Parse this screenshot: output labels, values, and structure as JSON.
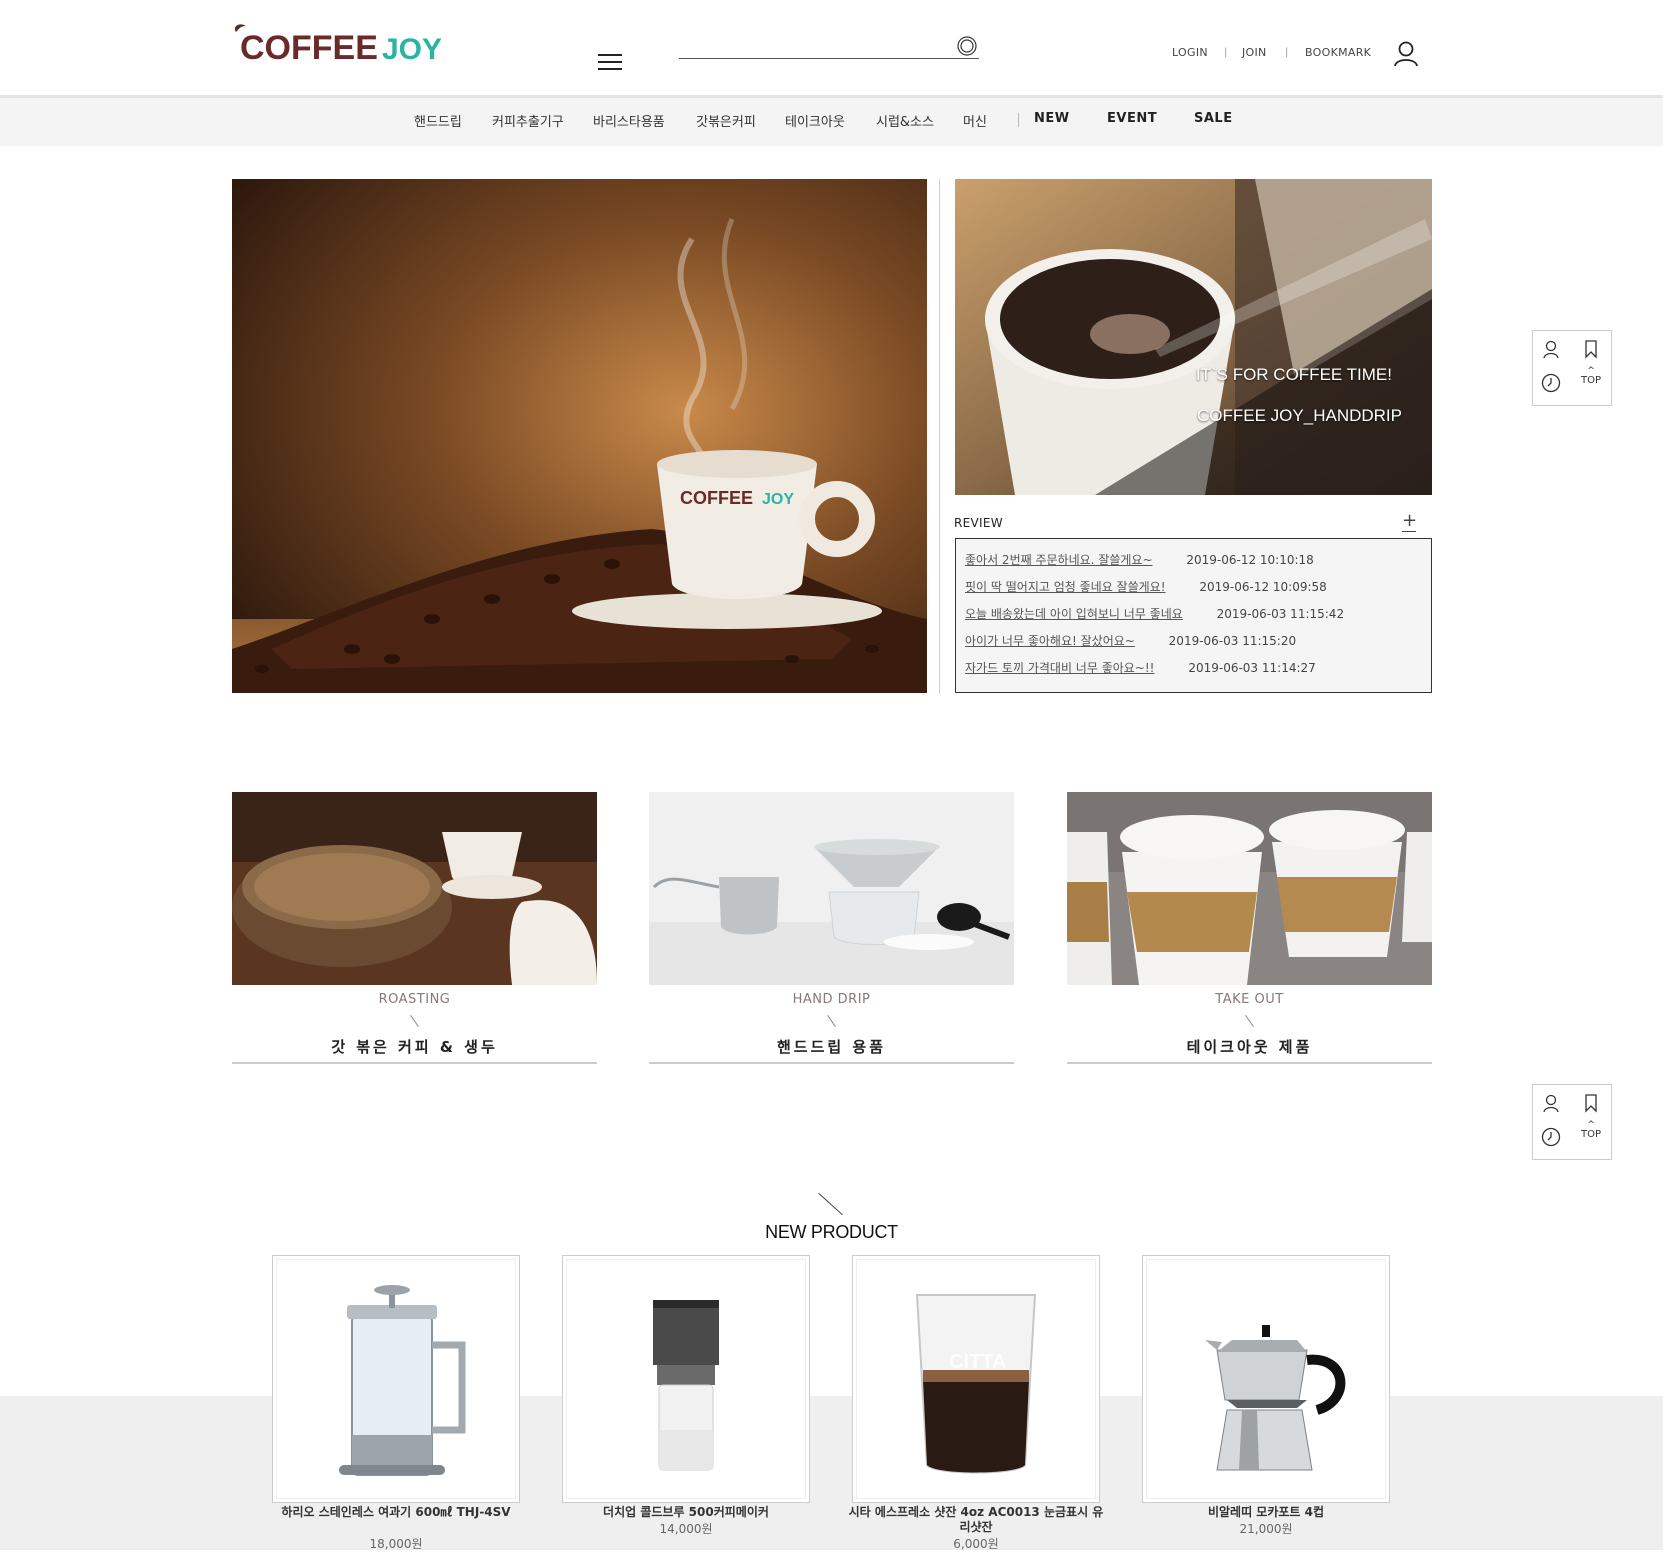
{
  "header": {
    "logo_text_main": "COFFEE",
    "logo_text_accent": "JOY",
    "search_placeholder": "",
    "links": {
      "login": "LOGIN",
      "join": "JOIN",
      "bookmark": "BOOKMARK",
      "separator": "|"
    }
  },
  "nav": {
    "items": [
      "핸드드립",
      "커피추출기구",
      "바리스타용품",
      "갓볶은커피",
      "테이크아웃",
      "시럽&소스",
      "머신"
    ],
    "strong_items": [
      "NEW",
      "EVENT",
      "SALE"
    ]
  },
  "hero": {
    "cup_logo_main": "COFFEE",
    "cup_logo_accent": "JOY",
    "title": "IT`S FOR COFFEE TIME!",
    "subtitle": "COFFEE JOY_HANDDRIP"
  },
  "review": {
    "title": "REVIEW",
    "more": "+",
    "items": [
      {
        "text": "좋아서 2번째 주문하네요. 잘쓸게요~",
        "date": "2019-06-12 10:10:18"
      },
      {
        "text": "핏이 딱 떨어지고 엄청 좋네요 잘쓸게요!",
        "date": "2019-06-12 10:09:58"
      },
      {
        "text": "오늘 배송왔는데 아이 입혀보니 너무 좋네요",
        "date": "2019-06-03 11:15:42"
      },
      {
        "text": "아이가 너무 좋아해요! 잘샀어요~",
        "date": "2019-06-03 11:15:20"
      },
      {
        "text": "자가드 토끼 가격대비 너무 좋아요~!!",
        "date": "2019-06-03 11:14:27"
      }
    ]
  },
  "quick": {
    "top_label": "TOP"
  },
  "categories": [
    {
      "en": "ROASTING",
      "ko": "갓 볶은 커피 & 생두"
    },
    {
      "en": "HAND DRIP",
      "ko": "핸드드립 용품"
    },
    {
      "en": "TAKE  OUT",
      "ko": "테이크아웃 제품"
    }
  ],
  "new_product": {
    "title": "NEW PRODUCT",
    "products": [
      {
        "name": "하리오 스테인레스 여과기 600㎖ THJ-4SV",
        "price": "18,000원",
        "icon": "french-press-icon"
      },
      {
        "name": "더치업 콜드브루 500커피메이커",
        "price": "14,000원",
        "icon": "cold-brew-icon"
      },
      {
        "name": "시타 에스프레소 샷잔 4oz AC0013 눈금표시 유리샷잔",
        "price": "6,000원",
        "icon": "shot-glass-icon"
      },
      {
        "name": "비알레띠 모카포트 4컵",
        "price": "21,000원",
        "icon": "moka-pot-icon"
      }
    ],
    "cups_logo": "CITTA"
  },
  "colors": {
    "logo_brown": "#5a2a22",
    "logo_teal": "#2bb3a3",
    "nav_bg": "#f4f4f4"
  }
}
